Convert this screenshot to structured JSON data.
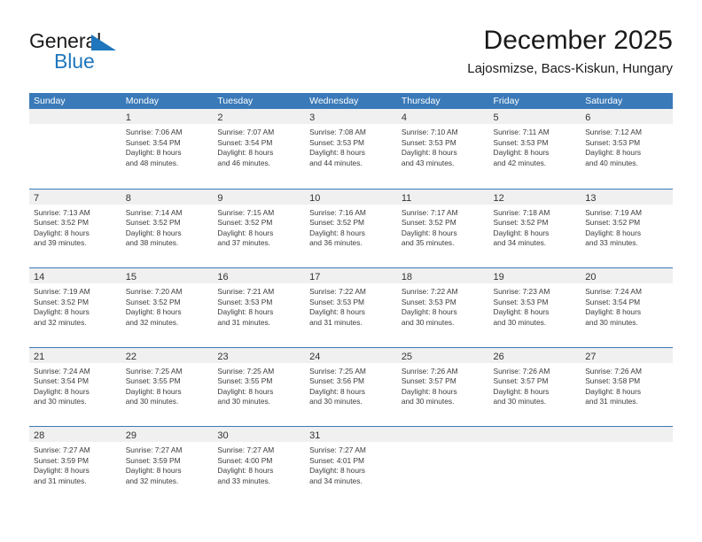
{
  "brand": {
    "name_part1": "General",
    "name_part2": "Blue",
    "flag_icon": "triangle-flag-icon",
    "accent_color": "#1f76bd"
  },
  "header": {
    "title": "December 2025",
    "subtitle": "Lajosmizse, Bacs-Kiskun, Hungary"
  },
  "theme": {
    "header_blue": "#3a7ab8",
    "daynum_band": "#f0f0f0",
    "text": "#3b3b3b"
  },
  "weekdays": [
    "Sunday",
    "Monday",
    "Tuesday",
    "Wednesday",
    "Thursday",
    "Friday",
    "Saturday"
  ],
  "weeks": [
    [
      {
        "day": "",
        "sunrise": "",
        "sunset": "",
        "daylight1": "",
        "daylight2": ""
      },
      {
        "day": "1",
        "sunrise": "Sunrise: 7:06 AM",
        "sunset": "Sunset: 3:54 PM",
        "daylight1": "Daylight: 8 hours",
        "daylight2": "and 48 minutes."
      },
      {
        "day": "2",
        "sunrise": "Sunrise: 7:07 AM",
        "sunset": "Sunset: 3:54 PM",
        "daylight1": "Daylight: 8 hours",
        "daylight2": "and 46 minutes."
      },
      {
        "day": "3",
        "sunrise": "Sunrise: 7:08 AM",
        "sunset": "Sunset: 3:53 PM",
        "daylight1": "Daylight: 8 hours",
        "daylight2": "and 44 minutes."
      },
      {
        "day": "4",
        "sunrise": "Sunrise: 7:10 AM",
        "sunset": "Sunset: 3:53 PM",
        "daylight1": "Daylight: 8 hours",
        "daylight2": "and 43 minutes."
      },
      {
        "day": "5",
        "sunrise": "Sunrise: 7:11 AM",
        "sunset": "Sunset: 3:53 PM",
        "daylight1": "Daylight: 8 hours",
        "daylight2": "and 42 minutes."
      },
      {
        "day": "6",
        "sunrise": "Sunrise: 7:12 AM",
        "sunset": "Sunset: 3:53 PM",
        "daylight1": "Daylight: 8 hours",
        "daylight2": "and 40 minutes."
      }
    ],
    [
      {
        "day": "7",
        "sunrise": "Sunrise: 7:13 AM",
        "sunset": "Sunset: 3:52 PM",
        "daylight1": "Daylight: 8 hours",
        "daylight2": "and 39 minutes."
      },
      {
        "day": "8",
        "sunrise": "Sunrise: 7:14 AM",
        "sunset": "Sunset: 3:52 PM",
        "daylight1": "Daylight: 8 hours",
        "daylight2": "and 38 minutes."
      },
      {
        "day": "9",
        "sunrise": "Sunrise: 7:15 AM",
        "sunset": "Sunset: 3:52 PM",
        "daylight1": "Daylight: 8 hours",
        "daylight2": "and 37 minutes."
      },
      {
        "day": "10",
        "sunrise": "Sunrise: 7:16 AM",
        "sunset": "Sunset: 3:52 PM",
        "daylight1": "Daylight: 8 hours",
        "daylight2": "and 36 minutes."
      },
      {
        "day": "11",
        "sunrise": "Sunrise: 7:17 AM",
        "sunset": "Sunset: 3:52 PM",
        "daylight1": "Daylight: 8 hours",
        "daylight2": "and 35 minutes."
      },
      {
        "day": "12",
        "sunrise": "Sunrise: 7:18 AM",
        "sunset": "Sunset: 3:52 PM",
        "daylight1": "Daylight: 8 hours",
        "daylight2": "and 34 minutes."
      },
      {
        "day": "13",
        "sunrise": "Sunrise: 7:19 AM",
        "sunset": "Sunset: 3:52 PM",
        "daylight1": "Daylight: 8 hours",
        "daylight2": "and 33 minutes."
      }
    ],
    [
      {
        "day": "14",
        "sunrise": "Sunrise: 7:19 AM",
        "sunset": "Sunset: 3:52 PM",
        "daylight1": "Daylight: 8 hours",
        "daylight2": "and 32 minutes."
      },
      {
        "day": "15",
        "sunrise": "Sunrise: 7:20 AM",
        "sunset": "Sunset: 3:52 PM",
        "daylight1": "Daylight: 8 hours",
        "daylight2": "and 32 minutes."
      },
      {
        "day": "16",
        "sunrise": "Sunrise: 7:21 AM",
        "sunset": "Sunset: 3:53 PM",
        "daylight1": "Daylight: 8 hours",
        "daylight2": "and 31 minutes."
      },
      {
        "day": "17",
        "sunrise": "Sunrise: 7:22 AM",
        "sunset": "Sunset: 3:53 PM",
        "daylight1": "Daylight: 8 hours",
        "daylight2": "and 31 minutes."
      },
      {
        "day": "18",
        "sunrise": "Sunrise: 7:22 AM",
        "sunset": "Sunset: 3:53 PM",
        "daylight1": "Daylight: 8 hours",
        "daylight2": "and 30 minutes."
      },
      {
        "day": "19",
        "sunrise": "Sunrise: 7:23 AM",
        "sunset": "Sunset: 3:53 PM",
        "daylight1": "Daylight: 8 hours",
        "daylight2": "and 30 minutes."
      },
      {
        "day": "20",
        "sunrise": "Sunrise: 7:24 AM",
        "sunset": "Sunset: 3:54 PM",
        "daylight1": "Daylight: 8 hours",
        "daylight2": "and 30 minutes."
      }
    ],
    [
      {
        "day": "21",
        "sunrise": "Sunrise: 7:24 AM",
        "sunset": "Sunset: 3:54 PM",
        "daylight1": "Daylight: 8 hours",
        "daylight2": "and 30 minutes."
      },
      {
        "day": "22",
        "sunrise": "Sunrise: 7:25 AM",
        "sunset": "Sunset: 3:55 PM",
        "daylight1": "Daylight: 8 hours",
        "daylight2": "and 30 minutes."
      },
      {
        "day": "23",
        "sunrise": "Sunrise: 7:25 AM",
        "sunset": "Sunset: 3:55 PM",
        "daylight1": "Daylight: 8 hours",
        "daylight2": "and 30 minutes."
      },
      {
        "day": "24",
        "sunrise": "Sunrise: 7:25 AM",
        "sunset": "Sunset: 3:56 PM",
        "daylight1": "Daylight: 8 hours",
        "daylight2": "and 30 minutes."
      },
      {
        "day": "25",
        "sunrise": "Sunrise: 7:26 AM",
        "sunset": "Sunset: 3:57 PM",
        "daylight1": "Daylight: 8 hours",
        "daylight2": "and 30 minutes."
      },
      {
        "day": "26",
        "sunrise": "Sunrise: 7:26 AM",
        "sunset": "Sunset: 3:57 PM",
        "daylight1": "Daylight: 8 hours",
        "daylight2": "and 30 minutes."
      },
      {
        "day": "27",
        "sunrise": "Sunrise: 7:26 AM",
        "sunset": "Sunset: 3:58 PM",
        "daylight1": "Daylight: 8 hours",
        "daylight2": "and 31 minutes."
      }
    ],
    [
      {
        "day": "28",
        "sunrise": "Sunrise: 7:27 AM",
        "sunset": "Sunset: 3:59 PM",
        "daylight1": "Daylight: 8 hours",
        "daylight2": "and 31 minutes."
      },
      {
        "day": "29",
        "sunrise": "Sunrise: 7:27 AM",
        "sunset": "Sunset: 3:59 PM",
        "daylight1": "Daylight: 8 hours",
        "daylight2": "and 32 minutes."
      },
      {
        "day": "30",
        "sunrise": "Sunrise: 7:27 AM",
        "sunset": "Sunset: 4:00 PM",
        "daylight1": "Daylight: 8 hours",
        "daylight2": "and 33 minutes."
      },
      {
        "day": "31",
        "sunrise": "Sunrise: 7:27 AM",
        "sunset": "Sunset: 4:01 PM",
        "daylight1": "Daylight: 8 hours",
        "daylight2": "and 34 minutes."
      },
      {
        "day": "",
        "sunrise": "",
        "sunset": "",
        "daylight1": "",
        "daylight2": ""
      },
      {
        "day": "",
        "sunrise": "",
        "sunset": "",
        "daylight1": "",
        "daylight2": ""
      },
      {
        "day": "",
        "sunrise": "",
        "sunset": "",
        "daylight1": "",
        "daylight2": ""
      }
    ]
  ]
}
